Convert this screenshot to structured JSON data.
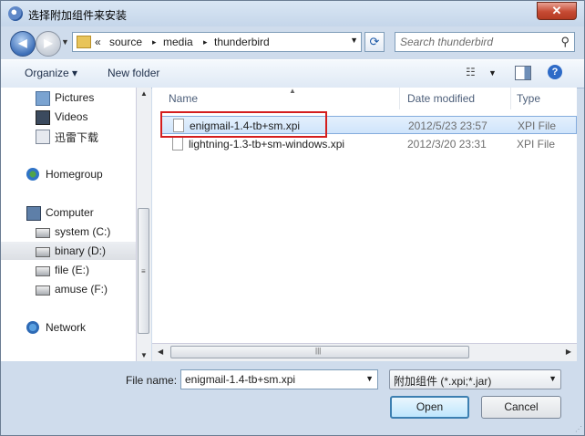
{
  "window": {
    "title": "选择附加组件来安装",
    "close_glyph": "✕"
  },
  "nav": {
    "back_glyph": "◀",
    "forward_glyph": "▶",
    "breadcrumb_overflow": "«",
    "breadcrumbs": [
      "source",
      "media",
      "thunderbird"
    ],
    "separators": [
      "▸",
      "▸"
    ],
    "search_placeholder": "Search thunderbird"
  },
  "toolbar": {
    "organize_label": "Organize ▾",
    "new_folder_label": "New folder",
    "help_glyph": "?"
  },
  "sidebar": {
    "items": [
      {
        "label": "Pictures",
        "icon": "pictures-icon"
      },
      {
        "label": "Videos",
        "icon": "videos-icon"
      },
      {
        "label": "迅雷下载",
        "icon": "download-folder-icon"
      },
      {
        "label": "Homegroup",
        "icon": "homegroup-icon"
      },
      {
        "label": "Computer",
        "icon": "computer-icon"
      },
      {
        "label": "system (C:)",
        "icon": "drive-icon"
      },
      {
        "label": "binary (D:)",
        "icon": "drive-icon"
      },
      {
        "label": "file (E:)",
        "icon": "drive-icon"
      },
      {
        "label": "amuse (F:)",
        "icon": "drive-icon"
      },
      {
        "label": "Network",
        "icon": "network-icon"
      }
    ],
    "selected": "binary (D:)"
  },
  "files": {
    "columns": [
      "Name",
      "Date modified",
      "Type"
    ],
    "rows": [
      {
        "name": "enigmail-1.4-tb+sm.xpi",
        "date": "2012/5/23 23:57",
        "type": "XPI File"
      },
      {
        "name": "lightning-1.3-tb+sm-windows.xpi",
        "date": "2012/3/20 23:31",
        "type": "XPI File"
      }
    ],
    "selected_row": 0
  },
  "bottom": {
    "file_name_label": "File name:",
    "file_name_value": "enigmail-1.4-tb+sm.xpi",
    "filter_value": "附加组件 (*.xpi;*.jar)",
    "open_label": "Open",
    "cancel_label": "Cancel"
  },
  "colors": {
    "highlight_box": "#d41e1e",
    "accent": "#3c7fb1"
  }
}
